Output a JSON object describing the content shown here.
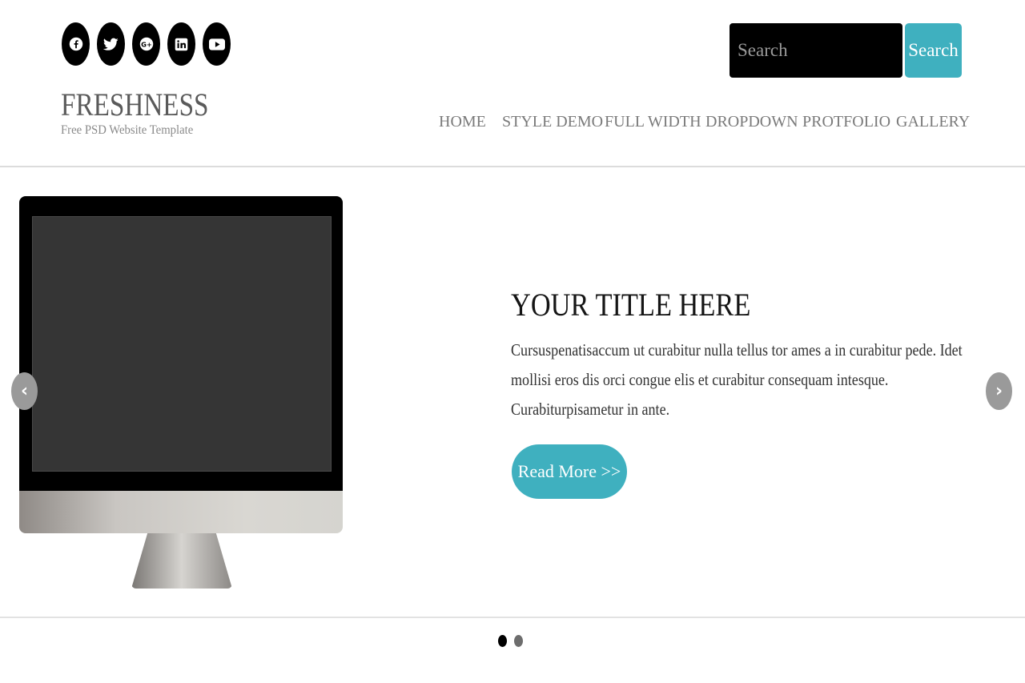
{
  "header": {
    "social": [
      {
        "icon": "facebook-icon"
      },
      {
        "icon": "twitter-icon"
      },
      {
        "icon": "google-plus-icon"
      },
      {
        "icon": "linkedin-icon"
      },
      {
        "icon": "youtube-icon"
      }
    ],
    "search": {
      "placeholder": "Search",
      "button_label": "Search"
    },
    "logo": {
      "title": "FRESHNESS",
      "subtitle": "Free PSD Website Template"
    },
    "nav": [
      {
        "label": "HOME"
      },
      {
        "label": "STYLE DEMO"
      },
      {
        "label": "FULL WIDTH"
      },
      {
        "label": "DROPDOWN"
      },
      {
        "label": "PROTFOLIO"
      },
      {
        "label": "GALLERY"
      }
    ]
  },
  "slider": {
    "title": "YOUR TITLE HERE",
    "text": "Cursuspenatisaccum ut curabitur nulla tellus tor ames a in curabitur pede. Idet mollisi eros dis orci congue elis et curabitur consequam intesque. Curabiturpisametur in ante.",
    "read_more_label": "Read More >>",
    "prev_arrow": "‹",
    "next_arrow": "›",
    "dots": [
      {
        "active": true
      },
      {
        "active": false
      }
    ]
  },
  "colors": {
    "accent": "#3fb0bf",
    "search_bg": "#000000",
    "nav_text": "#7a7a7a"
  }
}
